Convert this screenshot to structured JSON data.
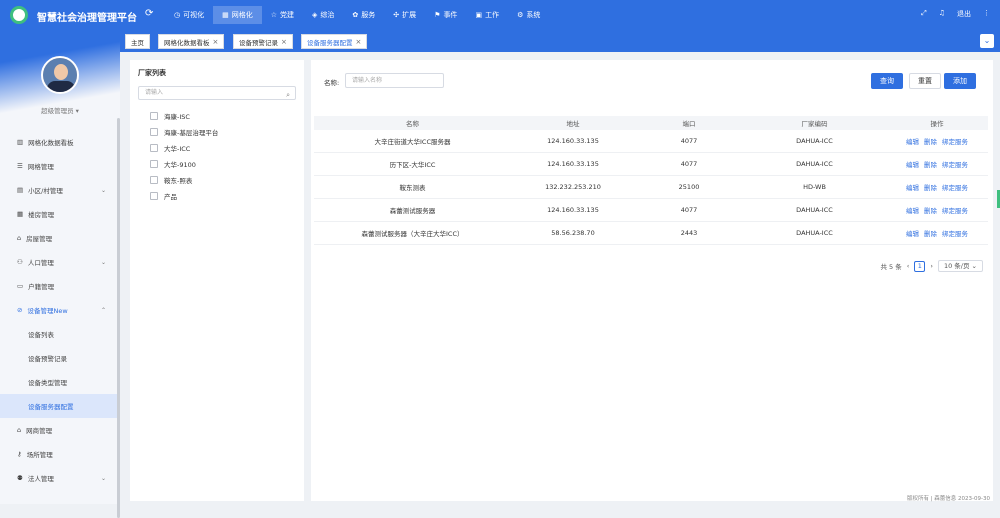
{
  "header": {
    "title": "智慧社会治理管理平台",
    "nav": [
      {
        "label": "可视化",
        "icon": "clock-icon"
      },
      {
        "label": "网格化",
        "icon": "grid-icon"
      },
      {
        "label": "党建",
        "icon": "star-icon"
      },
      {
        "label": "综治",
        "icon": "shield-icon"
      },
      {
        "label": "服务",
        "icon": "gear-icon"
      },
      {
        "label": "扩展",
        "icon": "puzzle-icon"
      },
      {
        "label": "事件",
        "icon": "flag-icon"
      },
      {
        "label": "工作",
        "icon": "briefcase-icon"
      },
      {
        "label": "系统",
        "icon": "settings-icon"
      }
    ],
    "logout_label": "退出"
  },
  "tabs": [
    {
      "label": "主页"
    },
    {
      "label": "网格化数据看板"
    },
    {
      "label": "设备预警记录"
    },
    {
      "label": "设备服务器配置"
    }
  ],
  "sidebar": {
    "user_name": "超级管理员",
    "menu": [
      {
        "label": "网格化数据看板",
        "icon": "chart-icon"
      },
      {
        "label": "网格管理",
        "icon": "list-icon"
      },
      {
        "label": "小区/村管理",
        "icon": "building-icon"
      },
      {
        "label": "楼房管理",
        "icon": "apartment-icon"
      },
      {
        "label": "房屋管理",
        "icon": "house-icon"
      },
      {
        "label": "人口管理",
        "icon": "people-icon"
      },
      {
        "label": "户籍管理",
        "icon": "id-card-icon"
      },
      {
        "label": "设备管理New",
        "icon": "link-icon"
      }
    ],
    "submenu": [
      {
        "label": "设备列表"
      },
      {
        "label": "设备预警记录"
      },
      {
        "label": "设备类型管理"
      },
      {
        "label": "设备服务器配置"
      }
    ],
    "menu_after": [
      {
        "label": "网商管理",
        "icon": "house-icon"
      },
      {
        "label": "场所管理",
        "icon": "key-icon"
      },
      {
        "label": "法人管理",
        "icon": "person-icon"
      }
    ]
  },
  "vendor_panel": {
    "title": "厂家列表",
    "search_placeholder": "请输入",
    "items": [
      "海康-ISC",
      "海康-基层治理平台",
      "大华-ICC",
      "大华-9100",
      "鞍东-照表",
      "产品"
    ]
  },
  "filter": {
    "name_label": "名称:",
    "name_placeholder": "请输入名称",
    "query_label": "查询",
    "reset_label": "重置",
    "add_label": "添加"
  },
  "table": {
    "columns": [
      "名称",
      "地址",
      "端口",
      "厂家编码",
      "操作"
    ],
    "rows": [
      {
        "name": "大辛庄街道大华ICC服务器",
        "address": "124.160.33.135",
        "port": "4077",
        "code": "DAHUA-ICC"
      },
      {
        "name": "历下区-大华ICC",
        "address": "124.160.33.135",
        "port": "4077",
        "code": "DAHUA-ICC"
      },
      {
        "name": "鞍东测表",
        "address": "132.232.253.210",
        "port": "25100",
        "code": "HD-WB"
      },
      {
        "name": "森蕾测试服务器",
        "address": "124.160.33.135",
        "port": "4077",
        "code": "DAHUA-ICC"
      },
      {
        "name": "森蕾测试服务器（大辛庄大华ICC）",
        "address": "58.56.238.70",
        "port": "2443",
        "code": "DAHUA-ICC"
      }
    ],
    "actions": [
      "编辑",
      "删除",
      "绑定服务"
    ]
  },
  "pagination": {
    "total": "共 5 条",
    "current_page": "1",
    "page_size": "10 条/页"
  },
  "footer": {
    "text": "版权所有 | 森蕾信息    2023-09-30"
  }
}
